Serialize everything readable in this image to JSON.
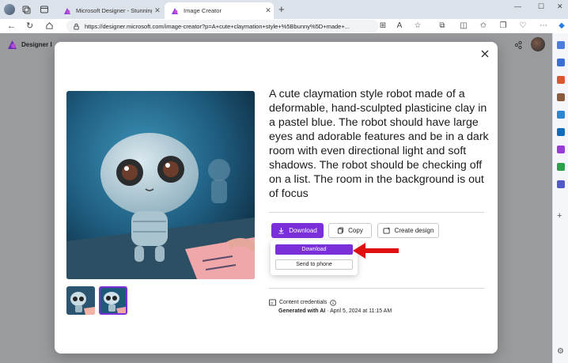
{
  "browser": {
    "tabs": [
      {
        "title": "Microsoft Designer - Stunning de",
        "active": false
      },
      {
        "title": "Image Creator",
        "active": true
      }
    ],
    "url": "https://designer.microsoft.com/image-creator?p=A+cute+claymation+style+%5Bbunny%5D+made+..."
  },
  "page": {
    "app_name": "Designer",
    "app_name_suffix": "I"
  },
  "dialog": {
    "prompt": "A cute claymation style robot made of a deformable, hand-sculpted plasticine clay in a pastel blue. The robot should have large eyes and adorable features and be in a dark room with even directional light and soft shadows. The robot should be checking off on a list. The room in the background is out of focus",
    "buttons": {
      "download": "Download",
      "copy": "Copy",
      "create_design": "Create design"
    },
    "download_menu": {
      "download": "Download",
      "send_to_phone": "Send to phone"
    },
    "content_credentials": {
      "label": "Content credentials",
      "generated_by": "Generated with AI",
      "generated_date": " · April 5, 2024 at 11:15 AM"
    },
    "thumbnails_count": 2,
    "selected_thumbnail": 2
  },
  "colors": {
    "accent": "#7a2fd8",
    "annotation_arrow": "#e01010",
    "overlay": "#9a9b9e"
  },
  "icons": [
    "close-icon",
    "download-icon",
    "copy-icon",
    "create-design-icon",
    "content-credentials-icon",
    "info-icon"
  ]
}
